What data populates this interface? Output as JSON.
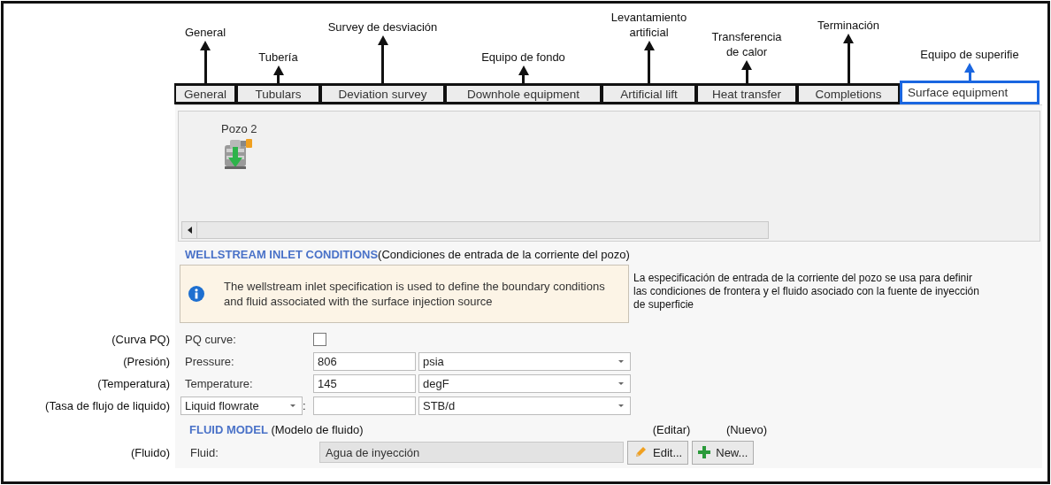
{
  "tabs": [
    {
      "label": "General",
      "annotation": "General",
      "selected": false
    },
    {
      "label": "Tubulars",
      "annotation": "Tubería",
      "selected": false
    },
    {
      "label": "Deviation survey",
      "annotation": "Survey de desviación",
      "selected": false
    },
    {
      "label": "Downhole equipment",
      "annotation": "Equipo de fondo",
      "selected": false
    },
    {
      "label": "Artificial lift",
      "annotation": "Levantamiento\nartificial",
      "selected": false
    },
    {
      "label": "Heat transfer",
      "annotation": "Transferencia\nde calor",
      "selected": false
    },
    {
      "label": "Completions",
      "annotation": "Terminación",
      "selected": false
    },
    {
      "label": "Surface equipment",
      "annotation": "Equipo de superifie",
      "selected": true
    }
  ],
  "canvas": {
    "well": {
      "label": "Pozo 2"
    }
  },
  "wellstream_section": {
    "title": "WELLSTREAM INLET CONDITIONS",
    "annotation": "(Condiciones de entrada de la corriente del pozo)",
    "info": "The wellstream inlet specification is used to define the boundary conditions and fluid associated with the surface injection source",
    "info_annotation": "La especificación de entrada de la corriente del pozo se usa para definir las condiciones de frontera y el fluido asociado con la fuente de inyección de superficie"
  },
  "fields": [
    {
      "kind": "checkbox",
      "annotation": "(Curva PQ)",
      "label": "PQ curve:",
      "checked": false
    },
    {
      "kind": "quantity",
      "annotation": "(Presión)",
      "label": "Pressure:",
      "value": "806",
      "unit": "psia"
    },
    {
      "kind": "quantity",
      "annotation": "(Temperatura)",
      "label": "Temperature:",
      "value": "145",
      "unit": "degF"
    },
    {
      "kind": "selectable",
      "annotation": "(Tasa de flujo de liquido)",
      "label": "Liquid flowrate",
      "separator": ":",
      "unit": "STB/d"
    }
  ],
  "fluid_model": {
    "title": "FLUID MODEL",
    "annotation": "(Modelo de fluido)",
    "field_annotation": "(Fluido)",
    "label": "Fluid:",
    "value": "Agua de inyección",
    "buttons": [
      {
        "kind": "edit",
        "label": "Edit...",
        "annotation": "(Editar)"
      },
      {
        "kind": "new",
        "label": "New...",
        "annotation": "(Nuevo)"
      }
    ]
  }
}
